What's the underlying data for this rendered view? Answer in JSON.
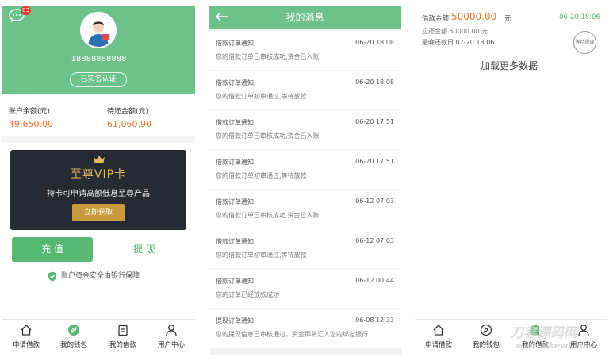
{
  "wallet": {
    "message_badge": "83",
    "phone": "18888888888",
    "verified_label": "已实名认证",
    "balance": {
      "label": "账户余额(元)",
      "value": "49,650.00"
    },
    "pending": {
      "label": "待还金额(元)",
      "value": "61,060.90"
    },
    "vip": {
      "title": "至尊VIP卡",
      "desc": "持卡可申请高额低息至尊产品",
      "button": "立即获取"
    },
    "recharge_label": "充 值",
    "withdraw_label": "提 现",
    "safety_text": "账户资金安全由银行保障"
  },
  "tabbar": {
    "apply": "申请借款",
    "wallet": "我的钱包",
    "loans": "我的借款",
    "user": "用户中心"
  },
  "messages": {
    "title": "我的消息",
    "items": [
      {
        "title": "借款订单通知",
        "time": "06-20 18:08",
        "body": "您的借款订单已审核成功,资金已入账"
      },
      {
        "title": "借款订单通知",
        "time": "06-20 18:08",
        "body": "您的借款订单初审通过,等待放款"
      },
      {
        "title": "借款订单通知",
        "time": "06-20 17:51",
        "body": "您的借款订单已审核成功,资金已入账"
      },
      {
        "title": "借款订单通知",
        "time": "06-20 17:51",
        "body": "您的借款订单初审通过,等待放款"
      },
      {
        "title": "借款订单通知",
        "time": "06-12 07:03",
        "body": "您的借款订单已审核成功,资金已入账"
      },
      {
        "title": "借款订单通知",
        "time": "06-12 07:03",
        "body": "您的借款订单初审通过,等待放款"
      },
      {
        "title": "借款订单通知",
        "time": "06-12 00:44",
        "body": "您的订单已经放款成功"
      },
      {
        "title": "提现订单通知",
        "time": "06-08 12:33",
        "body": "您的提现信息已审核通过，资金即将汇入您的绑定银行..."
      }
    ]
  },
  "loans": {
    "amount_label": "借款金额",
    "amount_value": "50000.00",
    "amount_unit": "元",
    "date": "06-20 18:06",
    "repay_text": "应还金额 50000.00 元",
    "deadline_text": "最晚还款日 07-20 18:06",
    "status": "等待提现",
    "load_more": "加载更多数据"
  },
  "watermark": {
    "top": "刀客源码网",
    "bottom": "www.dkewl.com"
  },
  "colors": {
    "green": "#6cc28a",
    "button_green": "#56b872",
    "orange": "#e8772e",
    "gold": "#e2b55f",
    "card_dark": "#262a33"
  }
}
